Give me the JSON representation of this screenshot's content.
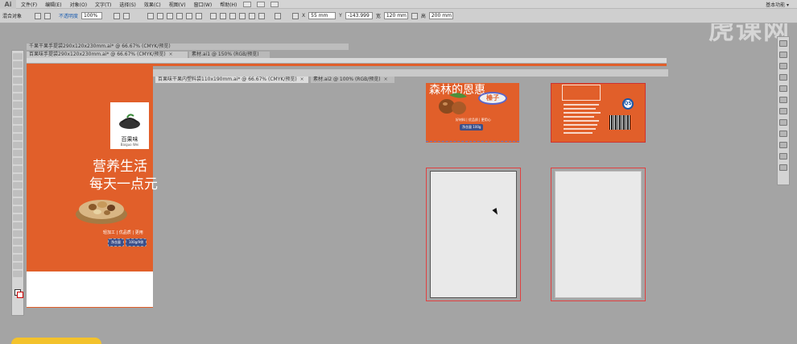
{
  "app": {
    "logo": "Ai",
    "workspace": "基本功能 ▾",
    "watermark": "虎课网"
  },
  "menu": [
    "文件(F)",
    "编辑(E)",
    "对象(O)",
    "文字(T)",
    "选择(S)",
    "效果(C)",
    "视图(V)",
    "窗口(W)",
    "帮助(H)"
  ],
  "control": {
    "mode_label": "混合对象",
    "opacity_link": "不透明度",
    "opacity_value": "100%",
    "x_label": "X",
    "x_value": "55 mm",
    "y_label": "Y",
    "y_value": "-143.999",
    "w_label": "宽",
    "w_value": "120 mm",
    "h_label": "高",
    "h_value": "200 mm"
  },
  "tabs": {
    "doc1": "千果干果手提袋290x120x230mm.ai* @ 66.67% (CMYK/预览)",
    "doc2": "百果味手提袋290x120x230mm.ai* @ 66.67% (CMYK/预览)",
    "doc3": "素材.ai1 @ 150% (RGB/预览)",
    "front1": "百果味干果内塑料袋110x190mm.ai* @ 66.67% (CMYK/预览)",
    "front2": "素材.ai2 @ 100% (RGB/预览)",
    "close": "×"
  },
  "left_doc": {
    "brand_name": "百果味",
    "brand_sub": "Baiguo Wei",
    "slogan_line1": "营养生活",
    "slogan_line2": "每天一点元",
    "features": "轻加工 | 优品质 | 更用",
    "pill1": "净含量",
    "pill2": "100g/9袋"
  },
  "front_art": {
    "title": "森林的恩惠",
    "badge": "榛子",
    "info": "好材料 | 优品质 | 更用心",
    "weight": "净含量 100g"
  },
  "back_art": {
    "qs": "QS"
  }
}
